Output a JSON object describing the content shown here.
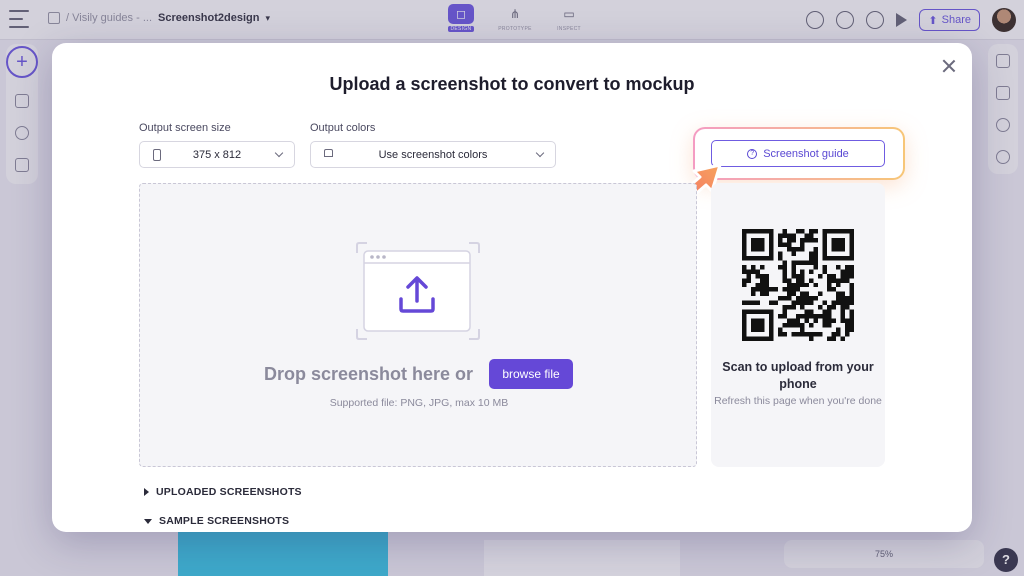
{
  "app": {
    "breadcrumb": {
      "parent": "/ Visily guides - ...",
      "current": "Screenshot2design"
    },
    "modes": [
      {
        "label": "DESIGN",
        "active": true
      },
      {
        "label": "PROTOTYPE",
        "active": false
      },
      {
        "label": "INSPECT",
        "active": false
      }
    ],
    "share_label": "Share",
    "zoom_level": "75%",
    "help_label": "?"
  },
  "modal": {
    "title": "Upload a screenshot to convert to mockup",
    "output_size": {
      "label": "Output screen size",
      "value": "375 x 812"
    },
    "output_colors": {
      "label": "Output colors",
      "value": "Use screenshot colors"
    },
    "guide_button": "Screenshot guide",
    "dropzone": {
      "prompt": "Drop screenshot here or",
      "browse_label": "browse file",
      "supported": "Supported file: PNG, JPG, max 10 MB"
    },
    "qr_panel": {
      "title": "Scan to upload from your phone",
      "subtitle": "Refresh this page when you're done"
    },
    "sections": [
      {
        "label": "UPLOADED SCREENSHOTS",
        "expanded": false
      },
      {
        "label": "SAMPLE SCREENSHOTS",
        "expanded": true
      }
    ]
  },
  "colors": {
    "accent": "#6548d7",
    "guide_highlight_start": "#f49cc3",
    "guide_highlight_end": "#f7c677",
    "arrow": "#f47a63"
  }
}
